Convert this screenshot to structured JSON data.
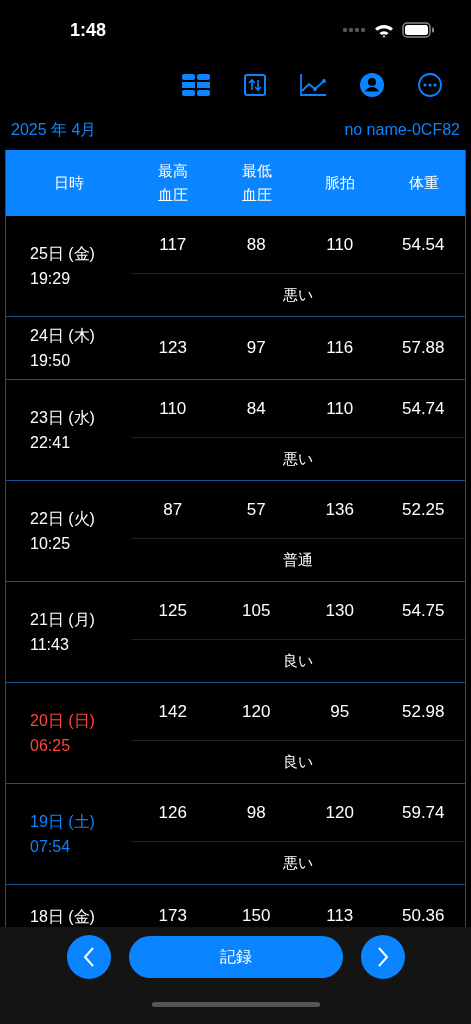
{
  "status_bar": {
    "time": "1:48"
  },
  "header": {
    "month": "2025 年 4月",
    "device": "no name-0CF82"
  },
  "table": {
    "columns": [
      "日時",
      "最高血圧",
      "最低血圧",
      "脈拍",
      "体重"
    ],
    "rows": [
      {
        "date": "25日 (金)",
        "time": "19:29",
        "color": "#ffffff",
        "values": [
          "117",
          "88",
          "110",
          "54.54"
        ],
        "note": "悪い"
      },
      {
        "date": "24日 (木)",
        "time": "19:50",
        "color": "#ffffff",
        "values": [
          "123",
          "97",
          "116",
          "57.88"
        ]
      },
      {
        "date": "23日 (水)",
        "time": "22:41",
        "color": "#ffffff",
        "values": [
          "110",
          "84",
          "110",
          "54.74"
        ],
        "note": "悪い"
      },
      {
        "date": "22日 (火)",
        "time": "10:25",
        "color": "#ffffff",
        "values": [
          "87",
          "57",
          "136",
          "52.25"
        ],
        "note": "普通"
      },
      {
        "date": "21日 (月)",
        "time": "11:43",
        "color": "#ffffff",
        "values": [
          "125",
          "105",
          "130",
          "54.75"
        ],
        "note": "良い"
      },
      {
        "date": "20日 (日)",
        "time": "06:25",
        "color": "#ff453a",
        "values": [
          "142",
          "120",
          "95",
          "52.98"
        ],
        "note": "良い"
      },
      {
        "date": "19日 (土)",
        "time": "07:54",
        "color": "#0a84ff",
        "values": [
          "126",
          "98",
          "120",
          "59.74"
        ],
        "note": "悪い"
      },
      {
        "date": "18日 (金)",
        "color": "#ffffff",
        "values": [
          "173",
          "150",
          "113",
          "50.36"
        ]
      }
    ]
  },
  "bottom_bar": {
    "record_button": "記録"
  }
}
